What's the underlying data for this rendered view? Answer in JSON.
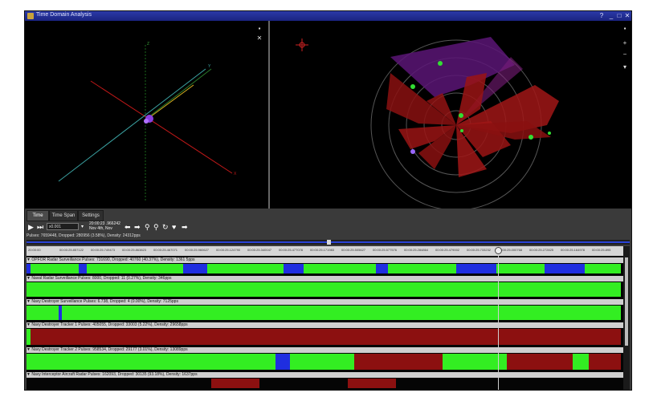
{
  "window": {
    "title": "Time Domain Analysis",
    "controls": {
      "help": "?",
      "minimize": "_",
      "maximize": "□",
      "close": "✕"
    }
  },
  "view3d": {
    "axis_labels": {
      "z": "Z",
      "y": "Y",
      "x": "X"
    }
  },
  "tabs": [
    {
      "label": "Time",
      "active": true
    },
    {
      "label": "Time Span",
      "active": false
    },
    {
      "label": "Settings",
      "active": false
    }
  ],
  "playback": {
    "speed_value": "x0.001",
    "timestamp_line1": "20:00:23 .966242",
    "timestamp_line2": "Nov 4th, Nov",
    "stats": "Pulses: 7659448, Dropped: 280956 (3.58%), Density: 24312pps"
  },
  "timeline": {
    "ticks": [
      "20:00:00",
      "00:00:25.857122",
      "00:00:25.749473",
      "00:00:25.863823",
      "00:00:25.467071",
      "00:00:25.960627",
      "00:00:25.124790",
      "00:00:25.340047",
      "00:00:25.477078",
      "00:00:25.171983",
      "00:00:25.505627",
      "00:00:25.577576",
      "00:00:25.284864",
      "00:00:25.479002",
      "00:00:25.733232",
      "00:00:25.000768",
      "00:00:25.272825",
      "00:00:25.164978",
      "00:00:25.895"
    ],
    "tracks": [
      {
        "name": "OPFOR Radar Surveillance",
        "stats": "Pulses: 731690, Dropped: 40760 (40.37%), Density: 1361 5pps"
      },
      {
        "name": "Naval Radar Surveillance",
        "stats": "Pulses: 8000, Dropped: 11 (0.27%), Density: 346pps"
      },
      {
        "name": "Navy Destroyer Surveillance",
        "stats": "Pulses: 6.738, Dropped: 4 (0.00%), Density: 7125pps"
      },
      {
        "name": "Navy Destroyer Tracker 1",
        "stats": "Pulses: 405055, Dropped: 33003 (5.22%), Density: 29658pps"
      },
      {
        "name": "Navy Destroyer Tracker 2",
        "stats": "Pulses: 958534, Dropped: 29177 (3.01%), Density: 13089pps"
      },
      {
        "name": "Navy Interceptor Aircraft Radar",
        "stats": "Pulses: 162093, Dropped: 30135 (93.18%), Density: 1637pps"
      }
    ]
  },
  "colors": {
    "green": "#33ee22",
    "blue": "#1f2ee0",
    "red": "#8c1010",
    "title_bar": "#2434a0"
  }
}
